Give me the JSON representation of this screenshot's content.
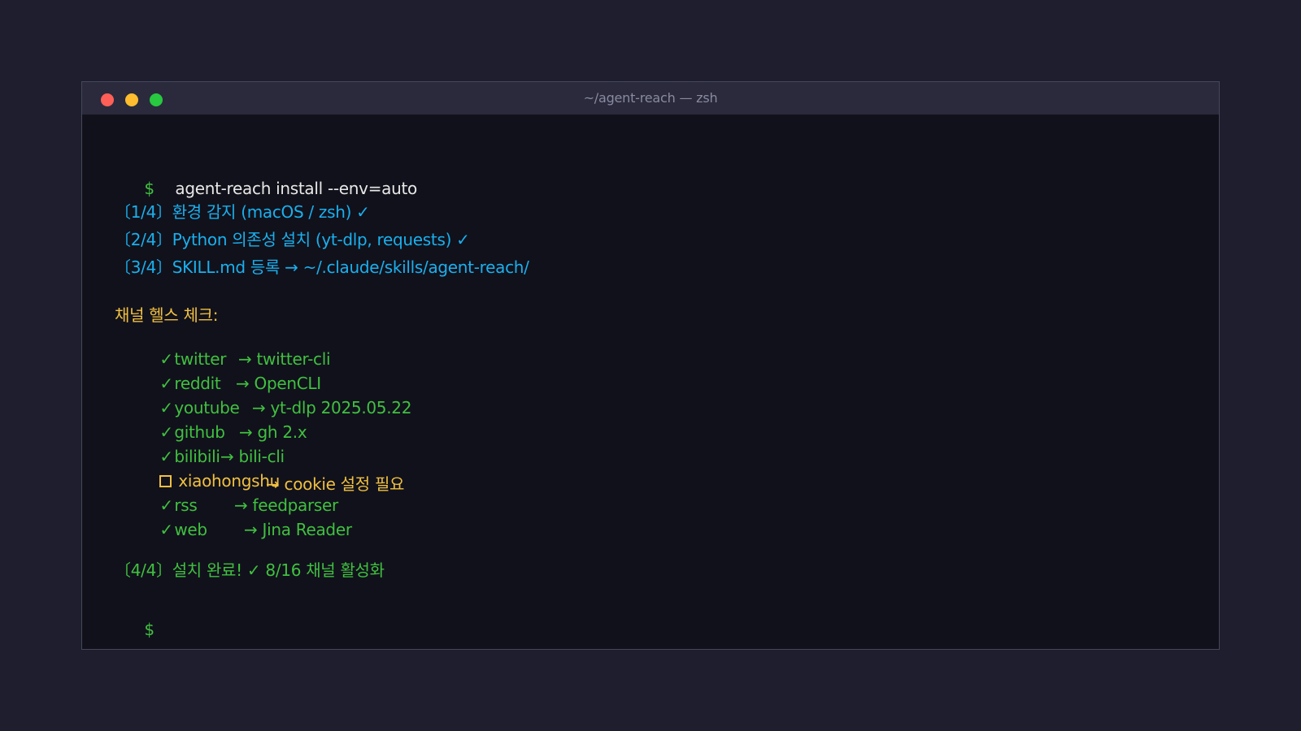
{
  "window": {
    "title": "~/agent-reach — zsh"
  },
  "terminal": {
    "prompt": "$",
    "command": "agent-reach install --env=auto",
    "steps": [
      "〔1/4〕환경 감지 (macOS / zsh) ✓",
      "〔2/4〕Python 의존성 설치 (yt-dlp, requests) ✓",
      "〔3/4〕SKILL.md 등록 → ~/.claude/skills/agent-reach/"
    ],
    "health_header": "채널 헬스 체크:",
    "channels": [
      {
        "status": "ok",
        "mark": "✓",
        "name": "twitter",
        "target": "→ twitter-cli"
      },
      {
        "status": "ok",
        "mark": "✓",
        "name": "reddit",
        "target": "→ OpenCLI"
      },
      {
        "status": "ok",
        "mark": "✓",
        "name": "youtube",
        "target": "→ yt-dlp 2025.05.22"
      },
      {
        "status": "ok",
        "mark": "✓",
        "name": "github",
        "target": "→ gh 2.x"
      },
      {
        "status": "ok",
        "mark": "✓",
        "name": "bilibili",
        "target": "→ bili-cli"
      },
      {
        "status": "warn",
        "mark": "",
        "name": "xiaohongshu",
        "target": "→ cookie 설정 필요"
      },
      {
        "status": "ok",
        "mark": "✓",
        "name": "rss",
        "target": "→ feedparser"
      },
      {
        "status": "ok",
        "mark": "✓",
        "name": "web",
        "target": "→ Jina Reader"
      }
    ],
    "final_step": "〔4/4〕설치 완료! ✓ 8/16 채널 활성화",
    "final_prompt": "$"
  },
  "colors": {
    "background": "#1e1e2e",
    "terminal_bg": "#11111b",
    "titlebar": "#2a2a3c",
    "prompt_green": "#40c040",
    "step_blue": "#1ab0ee",
    "warn_yellow": "#f0c040",
    "command_text": "#e8e8e8"
  }
}
